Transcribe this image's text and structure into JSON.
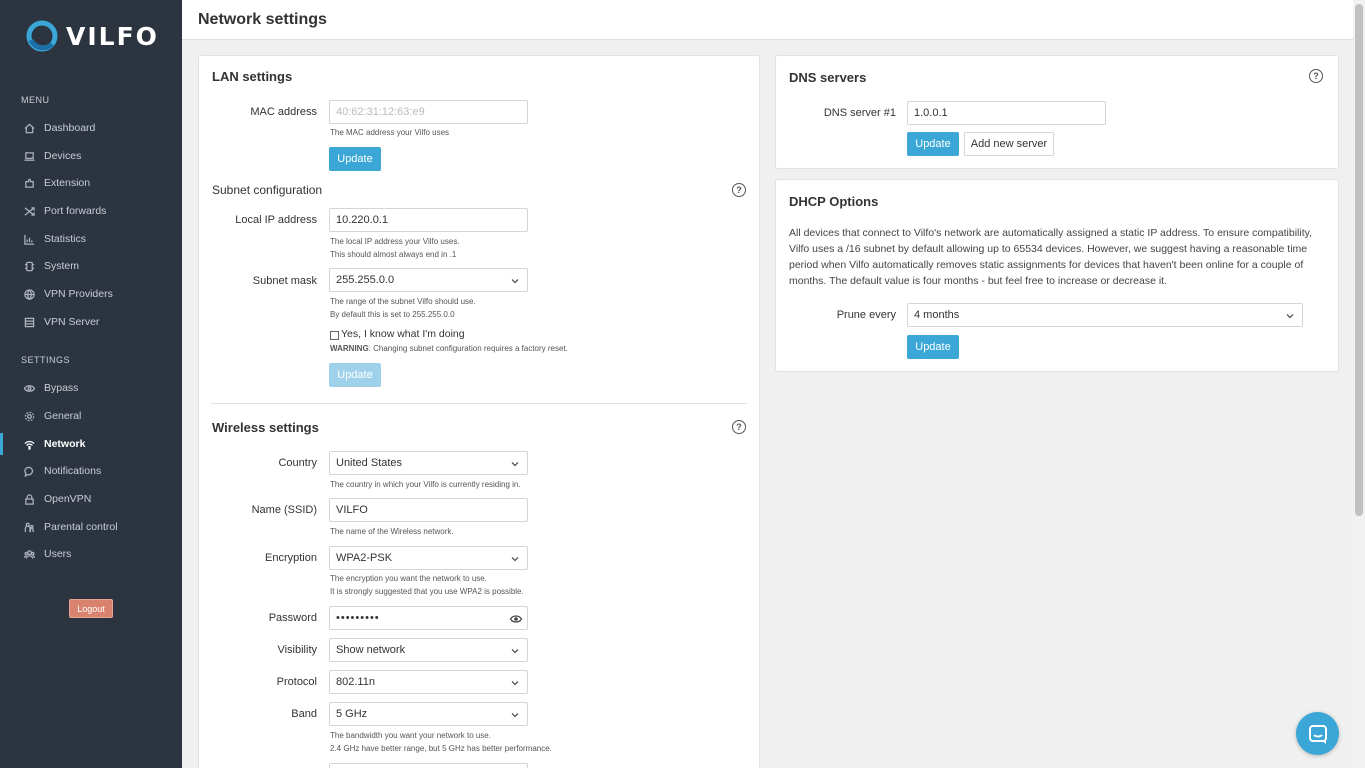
{
  "brand": {
    "name": "VILFO",
    "accent": "#3aa7d6"
  },
  "sidebar": {
    "menu_label": "MENU",
    "menu_items": [
      {
        "label": "Dashboard",
        "icon": "home-icon"
      },
      {
        "label": "Devices",
        "icon": "laptop-icon"
      },
      {
        "label": "Extension",
        "icon": "puzzle-icon"
      },
      {
        "label": "Port forwards",
        "icon": "shuffle-icon"
      },
      {
        "label": "Statistics",
        "icon": "chart-icon"
      },
      {
        "label": "System",
        "icon": "chip-icon"
      },
      {
        "label": "VPN Providers",
        "icon": "globe-icon"
      },
      {
        "label": "VPN Server",
        "icon": "server-icon"
      }
    ],
    "settings_label": "SETTINGS",
    "settings_items": [
      {
        "label": "Bypass",
        "icon": "eye-icon"
      },
      {
        "label": "General",
        "icon": "gear-icon"
      },
      {
        "label": "Network",
        "icon": "wifi-icon",
        "active": true
      },
      {
        "label": "Notifications",
        "icon": "chat-icon"
      },
      {
        "label": "OpenVPN",
        "icon": "lock-icon"
      },
      {
        "label": "Parental control",
        "icon": "parental-icon"
      },
      {
        "label": "Users",
        "icon": "users-icon"
      }
    ],
    "logout_label": "Logout"
  },
  "header": {
    "title": "Network settings"
  },
  "lan": {
    "title": "LAN settings",
    "mac_label": "MAC address",
    "mac_placeholder": "40:62:31:12:63:e9",
    "mac_help": "The MAC address your Vilfo uses",
    "update_label": "Update"
  },
  "subnet": {
    "title": "Subnet configuration",
    "ip_label": "Local IP address",
    "ip_value": "10.220.0.1",
    "ip_help_1": "The local IP address your Vilfo uses.",
    "ip_help_2": "This should almost always end in .1",
    "mask_label": "Subnet mask",
    "mask_value": "255.255.0.0",
    "mask_help_1": "The range of the subnet Vilfo should use.",
    "mask_help_2": "By default this is set to 255.255.0.0",
    "confirm_label": "Yes, I know what I'm doing",
    "warning_prefix": "WARNING",
    "warning_text": ": Changing subnet configuration requires a factory reset.",
    "update_label": "Update"
  },
  "wireless": {
    "title": "Wireless settings",
    "country_label": "Country",
    "country_value": "United States",
    "country_help": "The country in which your Vilfo is currently residing in.",
    "ssid_label": "Name (SSID)",
    "ssid_value": "VILFO",
    "ssid_help": "The name of the Wireless network.",
    "encryption_label": "Encryption",
    "encryption_value": "WPA2-PSK",
    "encryption_help_1": "The encryption you want the network to use.",
    "encryption_help_2": "It is strongly suggested that you use WPA2 is possible.",
    "password_label": "Password",
    "password_value": "•••••••••",
    "visibility_label": "Visibility",
    "visibility_value": "Show network",
    "protocol_label": "Protocol",
    "protocol_value": "802.11n",
    "band_label": "Band",
    "band_value": "5 GHz",
    "band_help_1": "The bandwidth you want your network to use.",
    "band_help_2": "2.4 GHz have better range, but 5 GHz has better performance."
  },
  "dns": {
    "title": "DNS servers",
    "server1_label": "DNS server #1",
    "server1_value": "1.0.0.1",
    "update_label": "Update",
    "add_label": "Add new server"
  },
  "dhcp": {
    "title": "DHCP Options",
    "description_lines": [
      "All devices that connect to Vilfo's network are automatically assigned a static IP address. To ensure compatibility,",
      "Vilfo uses a /16 subnet by default allowing up to 65534 devices. However, we suggest having a reasonable time",
      "period when Vilfo automatically removes static assignments for devices that haven't been online for a couple of",
      "months. The default value is four months - but feel free to increase or decrease it."
    ],
    "prune_label": "Prune every",
    "prune_value": "4 months",
    "update_label": "Update"
  }
}
